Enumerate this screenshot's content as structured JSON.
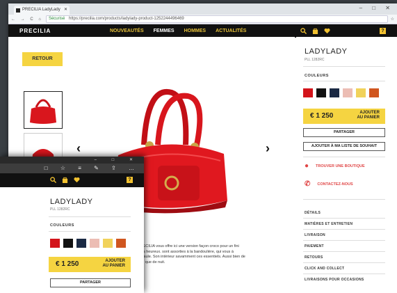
{
  "browser": {
    "tab_title": "PRECILIA LadyLady",
    "url_secure": "Sécurisé",
    "url": "https://precilia.com/products/ladylady-product-1252244496469",
    "nav_glyphs": "← → C ⌂",
    "star": "☆",
    "window_buttons": "– □ ✕"
  },
  "site": {
    "logo": "PRECILIA",
    "menu": [
      {
        "label": "NOUVEAUTÉS",
        "active": false
      },
      {
        "label": "FEMMES",
        "active": true
      },
      {
        "label": "HOMMES",
        "active": false
      },
      {
        "label": "ACTUALITÉS",
        "active": false
      }
    ],
    "help": "?"
  },
  "product": {
    "back_label": "RETOUR",
    "name": "LADYLADY",
    "ref": "PLL 1282RC",
    "colors_label": "COULEURS",
    "colors": [
      "#d3141b",
      "#121212",
      "#1b2a44",
      "#ecbdb4",
      "#f1d25a",
      "#d0561f"
    ],
    "price": "€ 1 250",
    "add_to_cart_1": "AJOUTER",
    "add_to_cart_2": "AU PANIER",
    "share": "PARTAGER",
    "wishlist": "AJOUTER À MA LISTE DE SOUHAIT",
    "find_store": "TROUVER UNE BOUTIQUE",
    "contact": "CONTACTEZ-NOUS",
    "description": "PRECILIA vous offre ici une version façon croco pour un fini ultra heureux. sont assorties à la bandoulière, qui vous à l'épaule. Son intérieur savamment ces essentiels. Aussi bien de jour que de nuit.",
    "accordion": [
      "DÉTAILS",
      "MATIÈRES ET ENTRETIEN",
      "LIVRAISON",
      "PAIEMENT",
      "RETOURS",
      "CLICK AND COLLECT",
      "LIVRAISONS POUR OCCASIONS"
    ]
  },
  "front_window": {
    "title_buttons": "– □ ✕",
    "toolbar_glyphs": "□ ☆ ≡ ✎ ⇪ …"
  }
}
